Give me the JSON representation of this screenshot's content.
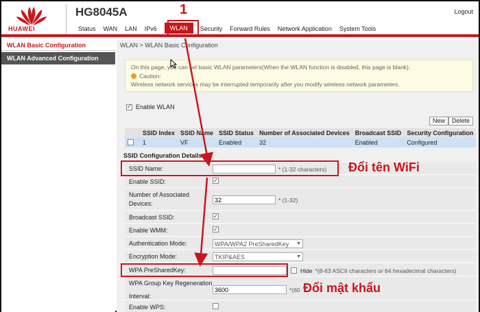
{
  "header": {
    "brand": "HUAWEI",
    "model": "HG8045A",
    "logout": "Logout",
    "nav": [
      "Status",
      "WAN",
      "LAN",
      "IPv6",
      "WLAN",
      "Security",
      "Forward Rules",
      "Network Application",
      "System Tools"
    ],
    "active_nav": "WLAN"
  },
  "sidebar": {
    "items": [
      "WLAN Basic Configuration",
      "WLAN Advanced Configuration"
    ]
  },
  "main": {
    "breadcrumb": "WLAN > WLAN Basic Configuration",
    "info": {
      "line1": "On this page, you can set basic WLAN parameters(When the WLAN function is disabled, this page is blank).",
      "caution": "Caution:",
      "line2": "Wireless network services may be interrupted temporarily after you modify wireless network parameters."
    },
    "enable_wlan": "Enable WLAN",
    "buttons": {
      "new": "New",
      "delete": "Delete"
    },
    "table": {
      "headers": [
        "",
        "SSID Index",
        "SSID Name",
        "SSID Status",
        "Number of Associated Devices",
        "Broadcast SSID",
        "Security Configuration"
      ],
      "rows": [
        [
          "",
          "1",
          "VF",
          "Enabled",
          "32",
          "Enabled",
          "Configured"
        ]
      ]
    },
    "details_title": "SSID Configuration Details",
    "form": {
      "ssid_name": {
        "label": "SSID Name:",
        "value": "",
        "hint": "* (1-32 characters)"
      },
      "enable_ssid": {
        "label": "Enable SSID:"
      },
      "num_devices": {
        "label1": "Number of Associated",
        "label2": "Devices:",
        "value": "32",
        "hint": "* (1-32)"
      },
      "broadcast_ssid": {
        "label": "Broadcast SSID:"
      },
      "enable_wmm": {
        "label": "Enable WMM:"
      },
      "auth_mode": {
        "label": "Authentication Mode:",
        "value": "WPA/WPA2 PreSharedKey"
      },
      "encryption_mode": {
        "label": "Encryption Mode:",
        "value": "TKIP&AES"
      },
      "wpa_key": {
        "label": "WPA PreSharedKey:",
        "value": "",
        "hide": "Hide",
        "hint": "*(8-63 ASCII characters or 64 hexadecimal characters)"
      },
      "wpa_regen": {
        "label1": "WPA Group Key Regeneration",
        "label2": "Interval:",
        "value": "3600",
        "hint": "*(60"
      },
      "enable_wps": {
        "label": "Enable WPS:"
      }
    }
  },
  "annotations": {
    "step": "1",
    "rename_wifi": "Đổi tên WiFi",
    "change_password": "Đổi mật khẩu"
  },
  "colors": {
    "accent": "#c8161d",
    "table_selected": "#cce0f6",
    "info_bg": "#fdfbe3"
  }
}
